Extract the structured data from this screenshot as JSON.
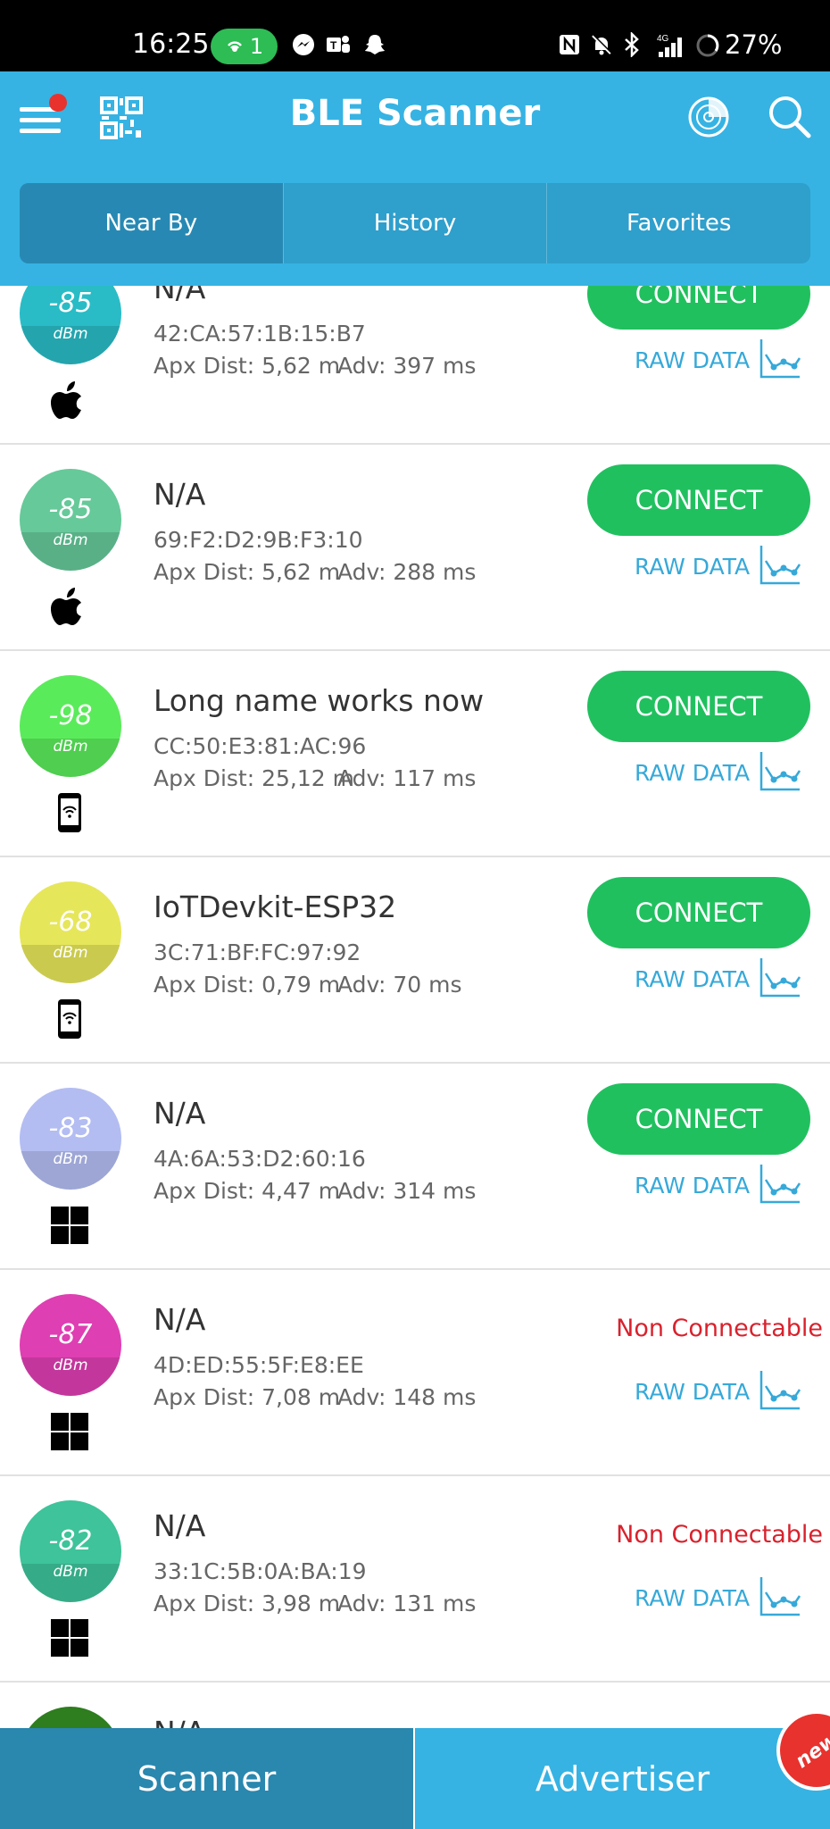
{
  "status_bar": {
    "time": "16:25",
    "hotspot_count": "1",
    "battery": "27%",
    "network": "4G",
    "icons": [
      "hotspot-icon",
      "messenger-icon",
      "teams-icon",
      "snapchat-icon",
      "nfc-icon",
      "mute-icon",
      "bluetooth-icon",
      "signal-icon",
      "battery-icon"
    ]
  },
  "app_bar": {
    "title": "BLE Scanner",
    "icons": [
      "menu-icon",
      "qr-code-icon",
      "radar-icon",
      "search-icon"
    ],
    "notification_dot_color": "#e8322e"
  },
  "tabs": [
    {
      "label": "Near By",
      "selected": true
    },
    {
      "label": "History",
      "selected": false
    },
    {
      "label": "Favorites",
      "selected": false
    }
  ],
  "devices": [
    {
      "name": "N/A",
      "mac": "42:CA:57:1B:15:B7",
      "dist": "Apx Dist: 5,62 m",
      "adv": "Adv: 397 ms",
      "rssi": "-85",
      "unit": "dBm",
      "color": "#29bcc6",
      "type": "apple-icon",
      "connectable": true
    },
    {
      "name": "N/A",
      "mac": "69:F2:D2:9B:F3:10",
      "dist": "Apx Dist: 5,62 m",
      "adv": "Adv: 288 ms",
      "rssi": "-85",
      "unit": "dBm",
      "color": "#66c99a",
      "type": "apple-icon",
      "connectable": true
    },
    {
      "name": "Long name works now",
      "mac": "CC:50:E3:81:AC:96",
      "dist": "Apx Dist: 25,12 m",
      "adv": "Adv: 117 ms",
      "rssi": "-98",
      "unit": "dBm",
      "color": "#5aeb5a",
      "type": "phone-icon",
      "connectable": true
    },
    {
      "name": "IoTDevkit-ESP32",
      "mac": "3C:71:BF:FC:97:92",
      "dist": "Apx Dist: 0,79 m",
      "adv": "Adv: 70 ms",
      "rssi": "-68",
      "unit": "dBm",
      "color": "#e6e65a",
      "type": "phone-icon",
      "connectable": true
    },
    {
      "name": "N/A",
      "mac": "4A:6A:53:D2:60:16",
      "dist": "Apx Dist: 4,47 m",
      "adv": "Adv: 314 ms",
      "rssi": "-83",
      "unit": "dBm",
      "color": "#b3bdf2",
      "type": "windows-icon",
      "connectable": true
    },
    {
      "name": "N/A",
      "mac": "4D:ED:55:5F:E8:EE",
      "dist": "Apx Dist: 7,08 m",
      "adv": "Adv: 148 ms",
      "rssi": "-87",
      "unit": "dBm",
      "color": "#de3fb2",
      "type": "windows-icon",
      "connectable": false
    },
    {
      "name": "N/A",
      "mac": "33:1C:5B:0A:BA:19",
      "dist": "Apx Dist: 3,98 m",
      "adv": "Adv: 131 ms",
      "rssi": "-82",
      "unit": "dBm",
      "color": "#3ec39a",
      "type": "windows-icon",
      "connectable": false
    },
    {
      "name": "N/A",
      "mac": "",
      "dist": "",
      "adv": "",
      "rssi": "",
      "unit": "",
      "color": "#2e7d1f",
      "type": "",
      "connectable": null
    }
  ],
  "labels": {
    "connect": "CONNECT",
    "non_connectable": "Non Connectable",
    "raw_data": "RAW DATA"
  },
  "bottom_nav": {
    "scanner": "Scanner",
    "advertiser": "Advertiser",
    "badge": "new"
  }
}
